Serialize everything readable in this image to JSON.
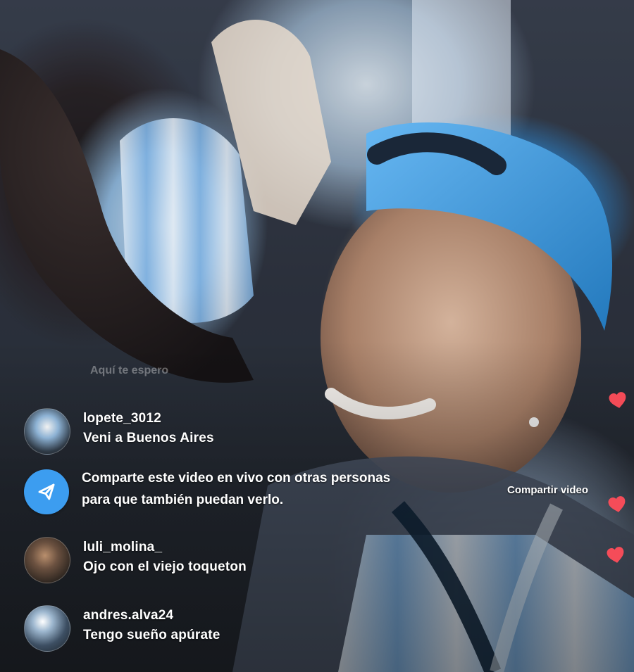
{
  "live_comments": {
    "faded_comment": "Aquí te espero",
    "comments": [
      {
        "username": "lopete_3012",
        "message": "Veni a Buenos Aires"
      },
      {
        "username": "luli_molina_",
        "message": "Ojo con el viejo toqueton"
      },
      {
        "username": "andres.alva24",
        "message": "Tengo sueño apúrate"
      }
    ]
  },
  "share_banner": {
    "line1": "Comparte este video en vivo con otras personas",
    "line2": "para que también puedan verlo.",
    "icon": "share-arrow-icon",
    "color": "#3c9df0"
  },
  "actions": {
    "share_video_label": "Compartir video"
  },
  "reactions": {
    "heart_icon": "heart-icon",
    "heart_color": "#ff4d5a"
  }
}
